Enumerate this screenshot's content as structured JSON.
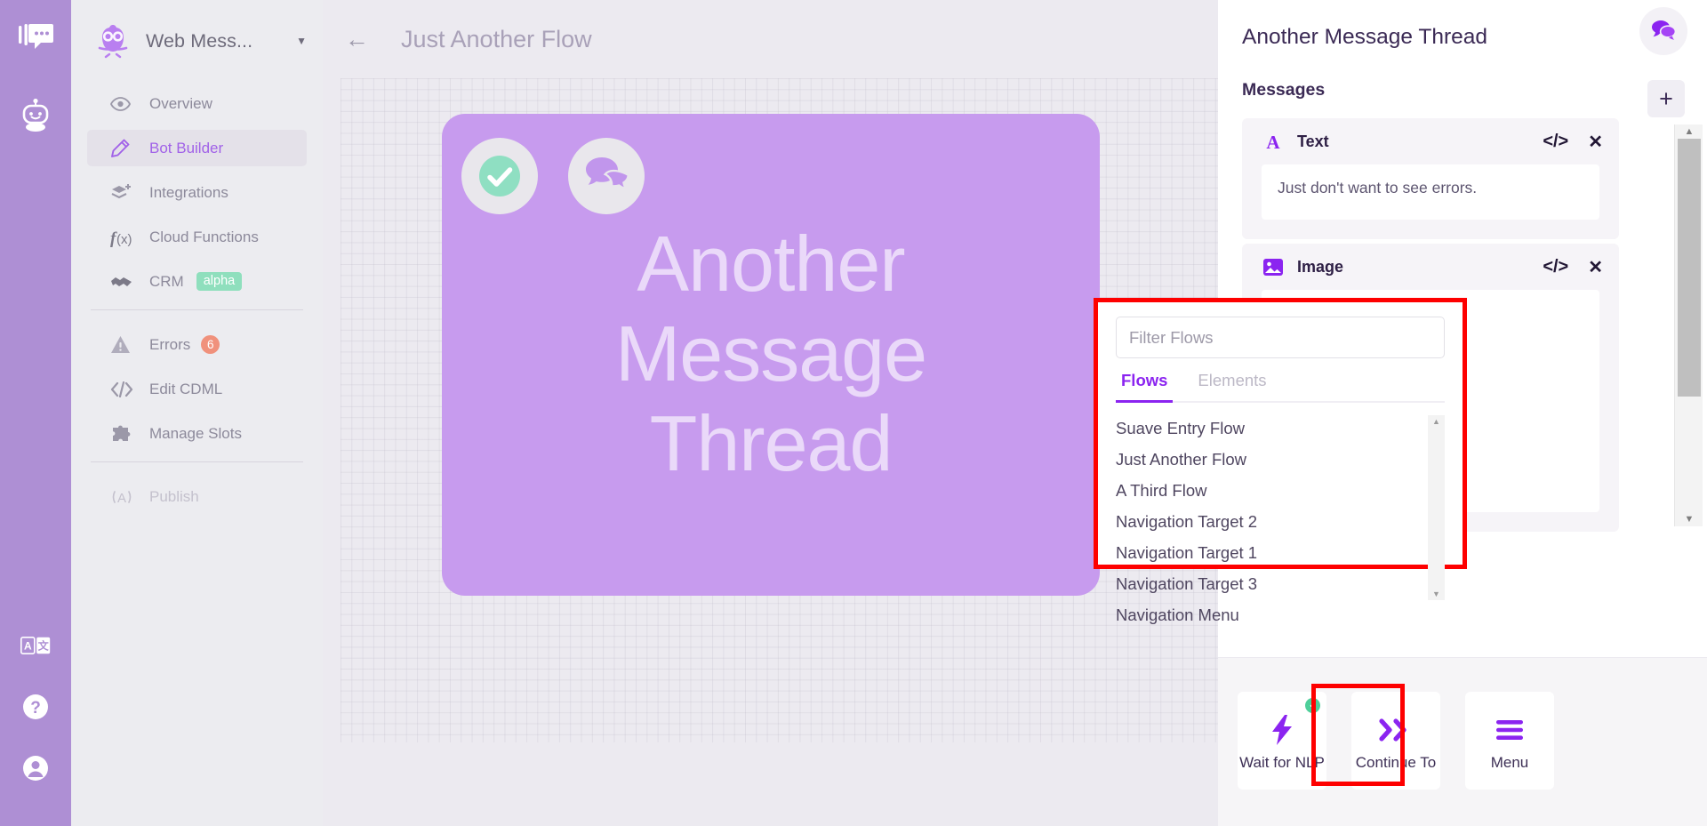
{
  "rail": {
    "logo_icon": "chat-logo-icon",
    "bot_icon": "bot-icon",
    "bottom_icons": [
      {
        "name": "translate-icon",
        "label": "Translate"
      },
      {
        "name": "help-icon",
        "label": "Help"
      },
      {
        "name": "account-icon",
        "label": "Account"
      }
    ]
  },
  "sidebar": {
    "brand": {
      "name": "Web Mess...",
      "caret": "▼",
      "logo_icon": "owl-logo-icon"
    },
    "items": [
      {
        "label": "Overview",
        "icon": "eye-icon",
        "state": "default"
      },
      {
        "label": "Bot Builder",
        "icon": "pencil-icon",
        "state": "active"
      },
      {
        "label": "Integrations",
        "icon": "layers-icon",
        "state": "default"
      },
      {
        "label": "Cloud Functions",
        "icon": "function-icon",
        "state": "default"
      },
      {
        "label": "CRM",
        "icon": "handshake-icon",
        "state": "default",
        "badge": "alpha"
      },
      {
        "label": "Errors",
        "icon": "warning-icon",
        "state": "default",
        "count": "6"
      },
      {
        "label": "Edit CDML",
        "icon": "code-icon",
        "state": "default"
      },
      {
        "label": "Manage Slots",
        "icon": "puzzle-icon",
        "state": "default"
      },
      {
        "label": "Publish",
        "icon": "broadcast-icon",
        "state": "disabled"
      }
    ]
  },
  "canvas": {
    "back_icon": "back-arrow-icon",
    "flow_title": "Just Another Flow",
    "card": {
      "check_icon": "check-circle-icon",
      "chat_icon": "chat-bubbles-icon",
      "title_lines": [
        "Another",
        "Message",
        "Thread"
      ]
    }
  },
  "right_panel": {
    "title": "Another Message Thread",
    "section_label": "Messages",
    "chat_button_icon": "chat-bubbles-icon",
    "add_button_label": "+",
    "messages": [
      {
        "type_label": "Text",
        "type_icon": "text-A-icon",
        "code_action": "</>",
        "close_action": "✕",
        "content": "Just don't want to see errors."
      },
      {
        "type_label": "Image",
        "type_icon": "image-icon",
        "code_action": "</>",
        "close_action": "✕",
        "content": ""
      }
    ],
    "toolbar": [
      {
        "label": "Wait for NLP",
        "icon": "lightning-icon",
        "checked": true,
        "highlighted": false
      },
      {
        "label": "Continue To",
        "icon": "chevrons-right-icon",
        "checked": false,
        "highlighted": true
      },
      {
        "label": "Menu",
        "icon": "hamburger-icon",
        "checked": false,
        "highlighted": false
      }
    ]
  },
  "flow_picker": {
    "filter_placeholder": "Filter Flows",
    "filter_value": "",
    "tabs": [
      {
        "label": "Flows",
        "active": true
      },
      {
        "label": "Elements",
        "active": false
      }
    ],
    "flows": [
      "Suave Entry Flow",
      "Just Another Flow",
      "A Third Flow",
      "Navigation Target 2",
      "Navigation Target 1",
      "Navigation Target 3",
      "Navigation Menu"
    ],
    "highlight_color": "#fe0000"
  },
  "colors": {
    "rail_purple": "#ae8fd4",
    "sidebar_bg": "#ececf0",
    "canvas_bg": "#eceaf0",
    "card_purple": "#c79bee",
    "accent_purple": "#8b24f0",
    "active_nav": "#a162e8",
    "badge_green": "#8fdfbd",
    "badge_orange": "#f0917c",
    "highlight_red": "#fe0000"
  }
}
